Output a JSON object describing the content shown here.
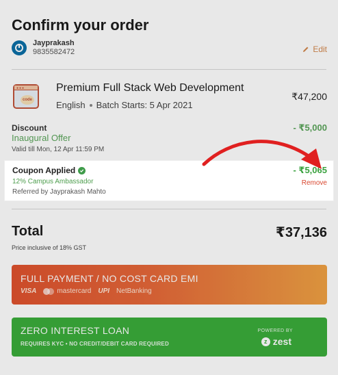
{
  "title": "Confirm your order",
  "user": {
    "name": "Jayprakash",
    "phone": "9835582472",
    "edit_label": "Edit"
  },
  "course": {
    "title": "Premium Full Stack Web Development",
    "language": "English",
    "batch": "Batch Starts: 5 Apr 2021",
    "price": "₹47,200",
    "icon_text": "code"
  },
  "discount": {
    "label": "Discount",
    "name": "Inaugural Offer",
    "validity": "Valid till Mon, 12 Apr 11:59 PM",
    "amount": "- ₹5,000"
  },
  "coupon": {
    "label": "Coupon Applied",
    "description": "12% Campus Ambassador",
    "referral": "Referred by Jayprakash Mahto",
    "amount": "- ₹5,065",
    "remove_label": "Remove"
  },
  "total": {
    "label": "Total",
    "amount": "₹37,136",
    "note": "Price inclusive of 18% GST"
  },
  "full_payment": {
    "label": "FULL PAYMENT / NO COST CARD EMI",
    "methods": [
      "VISA",
      "mastercard",
      "UPI",
      "NetBanking"
    ]
  },
  "loan": {
    "label": "ZERO INTEREST LOAN",
    "sub": "REQUIRES KYC • NO CREDIT/DEBIT CARD REQUIRED",
    "powered_by": "POWERED BY",
    "provider": "zest"
  },
  "colors": {
    "accent_orange": "#e0522e",
    "green_discount": "#5ba55b",
    "loan_green": "#3bad3b",
    "remove_red": "#d9472f",
    "arrow_red": "#e02020"
  }
}
